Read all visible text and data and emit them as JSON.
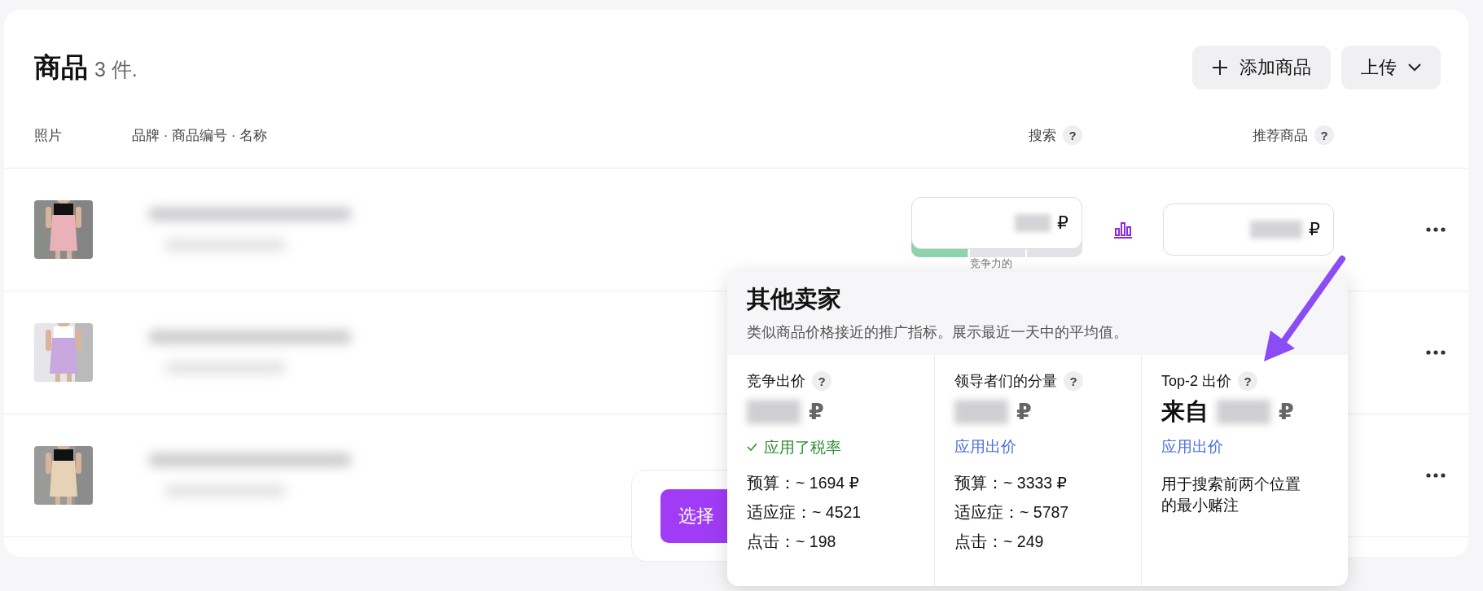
{
  "header": {
    "title": "商品",
    "count": "3 件.",
    "buttons": [
      {
        "kind": "add",
        "label": "添加商品"
      },
      {
        "kind": "dropdown",
        "label": "上传"
      }
    ]
  },
  "table": {
    "columns": [
      {
        "label": "照片"
      },
      {
        "label": "品牌 · 商品编号 · 名称"
      },
      {
        "label": "搜索",
        "help": "?"
      },
      {
        "label": "推荐商品",
        "help": "?"
      }
    ],
    "rows": [
      {
        "photo": {
          "kind": "picture"
        },
        "search_bid": {
          "currency": "₽",
          "competitiveness": {
            "level": 0.33,
            "label": "竞争力的"
          }
        },
        "recommend_bid": {
          "currency": "₽"
        }
      },
      {
        "photo": {
          "kind": "picture"
        }
      },
      {
        "photo": {
          "kind": "picture"
        }
      }
    ]
  },
  "action_bar": {
    "button": "选择"
  },
  "popover": {
    "title": "其他卖家",
    "subtitle": "类似商品价格接近的推广指标。展示最近一天中的平均值。",
    "columns": [
      {
        "label": "竞争出价",
        "help": "?",
        "currency": "₽",
        "action": {
          "kind": "status",
          "text": "应用了税率"
        },
        "stats": [
          "预算：~ 1694 ₽",
          "适应症：~ 4521",
          "点击：~ 198"
        ]
      },
      {
        "label": "领导者们的分量",
        "help": "?",
        "currency": "₽",
        "action": {
          "kind": "link",
          "text": "应用出价"
        },
        "stats": [
          "预算：~ 3333 ₽",
          "适应症：~ 5787",
          "点击：~ 249"
        ]
      },
      {
        "label": "Top-2 出价",
        "help": "?",
        "prefix": "来自",
        "currency": "₽",
        "action": {
          "kind": "link",
          "text": "应用出价"
        },
        "note": "用于搜索前两个位置的最小赌注"
      }
    ]
  }
}
